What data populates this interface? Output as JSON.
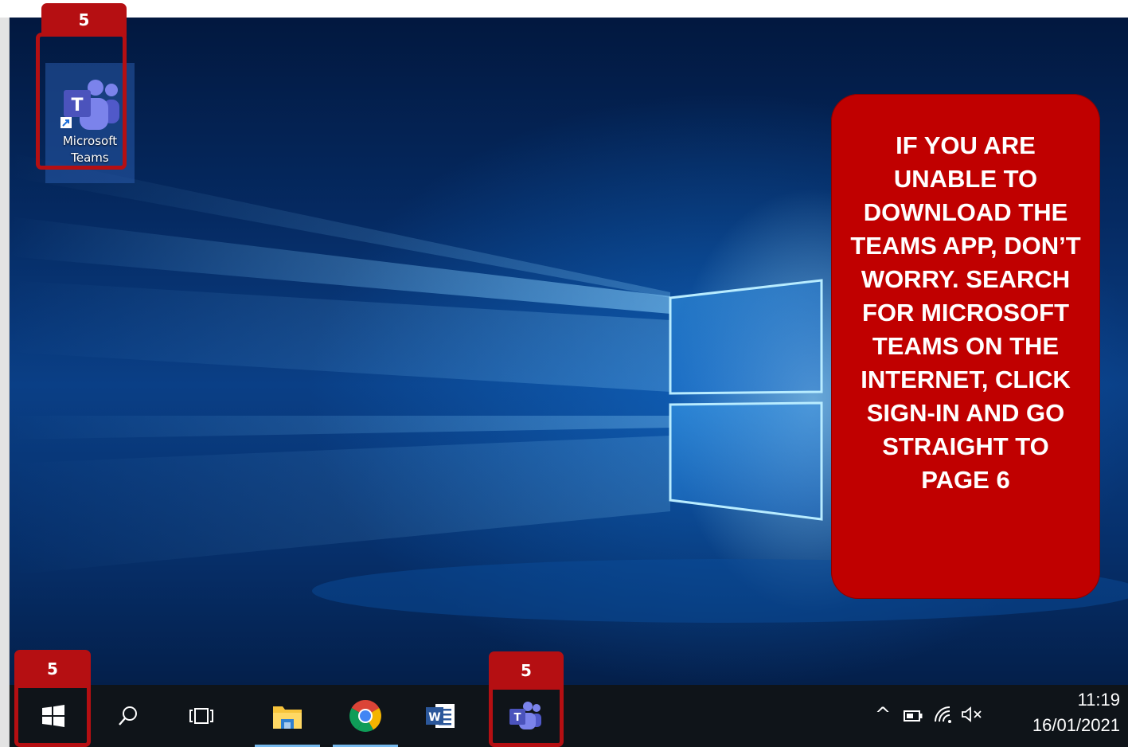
{
  "desktop": {
    "icon": {
      "name": "teams-icon",
      "label": "Microsoft Teams"
    }
  },
  "callouts": {
    "step_number": "5"
  },
  "info_box": {
    "text": "IF YOU ARE UNABLE TO DOWNLOAD THE TEAMS APP, DON’T WORRY. SEARCH FOR MICROSOFT TEAMS ON THE INTERNET, CLICK SIGN-IN AND GO STRAIGHT TO PAGE 6"
  },
  "taskbar": {
    "apps": [
      {
        "icon": "windows-start-icon"
      },
      {
        "icon": "search-icon"
      },
      {
        "icon": "task-view-icon"
      },
      {
        "icon": "file-explorer-icon"
      },
      {
        "icon": "chrome-icon"
      },
      {
        "icon": "word-icon"
      },
      {
        "icon": "teams-icon"
      }
    ],
    "tray": {
      "show_hidden": "^",
      "time": "11:19",
      "date": "16/01/2021"
    }
  },
  "colors": {
    "callout_red": "#b50f12",
    "info_red": "#c00000",
    "taskbar": "#0f1419",
    "teams_purple": "#5059c9"
  }
}
